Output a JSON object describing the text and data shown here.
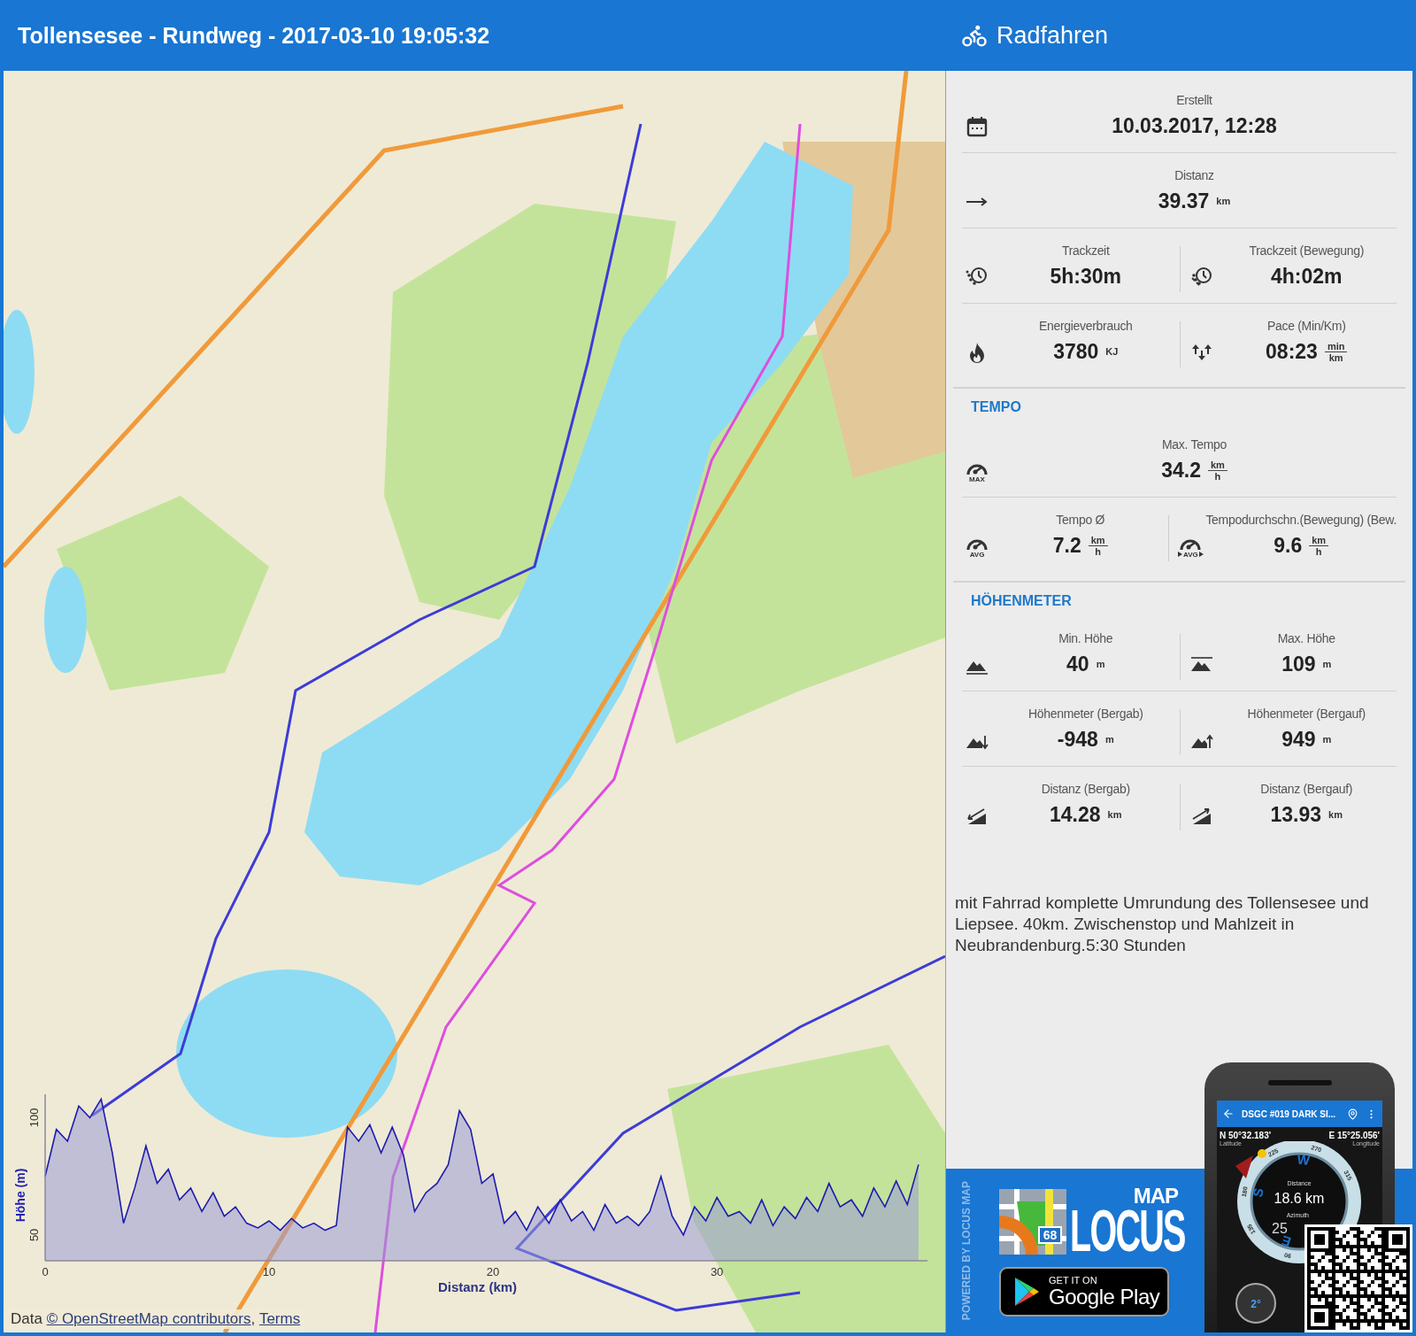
{
  "header": {
    "title": "Tollensesee - Rundweg - 2017-03-10 19:05:32",
    "activity": {
      "kind": "bike",
      "label": "Radfahren"
    }
  },
  "map": {
    "kind": "picture",
    "elevation_profile": {
      "chart_data": {
        "type": "area",
        "xlabel": "Distanz (km)",
        "ylabel": "Höhe (m)",
        "x": [
          0,
          0.5,
          1,
          1.5,
          2,
          2.5,
          3,
          3.5,
          4,
          4.5,
          5,
          5.5,
          6,
          6.5,
          7,
          7.5,
          8,
          8.5,
          9,
          9.5,
          10,
          10.5,
          11,
          11.5,
          12,
          12.5,
          13,
          13.5,
          14,
          14.5,
          15,
          15.5,
          16,
          16.5,
          17,
          17.5,
          18,
          18.5,
          19,
          19.5,
          20,
          20.5,
          21,
          21.5,
          22,
          22.5,
          23,
          23.5,
          24,
          24.5,
          25,
          25.5,
          26,
          26.5,
          27,
          27.5,
          28,
          28.5,
          29,
          29.5,
          30,
          30.5,
          31,
          31.5,
          32,
          32.5,
          33,
          33.5,
          34,
          34.5,
          35,
          35.5,
          36,
          36.5,
          37,
          37.5,
          38,
          38.5,
          39
        ],
        "series": [
          {
            "color": "#1c1cae",
            "values": [
              75,
              95,
              90,
              105,
              100,
              108,
              85,
              55,
              70,
              88,
              72,
              78,
              65,
              70,
              60,
              68,
              58,
              62,
              55,
              53,
              56,
              52,
              57,
              53,
              55,
              52,
              54,
              96,
              90,
              97,
              85,
              96,
              84,
              60,
              68,
              72,
              80,
              103,
              95,
              72,
              76,
              55,
              60,
              52,
              62,
              55,
              65,
              56,
              60,
              52,
              63,
              55,
              58,
              54,
              60,
              75,
              58,
              50,
              62,
              56,
              66,
              58,
              60,
              55,
              65,
              54,
              62,
              57,
              66,
              60,
              72,
              62,
              65,
              58,
              70,
              62,
              73,
              63,
              80
            ]
          }
        ],
        "xlim": [
          0,
          39.4
        ],
        "ylim": [
          39,
          110
        ],
        "xticks": [
          0,
          10,
          20,
          30
        ],
        "yticks": [
          50,
          100
        ]
      }
    },
    "attribution": {
      "prefix": "Data",
      "link": "© OpenStreetMap contributors",
      "separator": ",",
      "terms": "Terms"
    }
  },
  "stats": {
    "sections": [
      {
        "rows": [
          {
            "cells": [
              {
                "kind": "calendar",
                "label": "Erstellt",
                "value": "10.03.2017, 12:28"
              }
            ]
          },
          {
            "cells": [
              {
                "kind": "arrow",
                "label": "Distanz",
                "value": "39.37",
                "unit": "km"
              }
            ]
          },
          {
            "cells": [
              {
                "kind": "clock",
                "label": "Trackzeit",
                "value": "5h:30m"
              },
              {
                "kind": "clockmoving",
                "label": "Trackzeit (Bewegung)",
                "value": "4h:02m"
              }
            ]
          },
          {
            "cells": [
              {
                "kind": "flame",
                "label": "Energieverbrauch",
                "value": "3780",
                "unit": "KJ"
              },
              {
                "kind": "pace",
                "label": "Pace (Min/Km)",
                "value": "08:23",
                "unit_fraction": [
                  "min",
                  "km"
                ]
              }
            ]
          }
        ]
      },
      {
        "heading": "TEMPO",
        "rows": [
          {
            "cells": [
              {
                "kind": "gauge",
                "icon_text": "MAX",
                "label": "Max. Tempo",
                "value": "34.2",
                "unit_fraction": [
                  "km",
                  "h"
                ]
              }
            ]
          },
          {
            "cells": [
              {
                "kind": "gauge",
                "icon_text": "AVG",
                "label": "Tempo Ø",
                "value": "7.2",
                "unit_fraction": [
                  "km",
                  "h"
                ]
              },
              {
                "kind": "gaugemoving",
                "icon_text": "AVG",
                "label": "Tempodurchschn.(Bewegung) (Bew.",
                "value": "9.6",
                "unit_fraction": [
                  "km",
                  "h"
                ]
              }
            ]
          }
        ]
      },
      {
        "heading": "HÖHENMETER",
        "rows": [
          {
            "cells": [
              {
                "kind": "minheight",
                "label": "Min. Höhe",
                "value": "40",
                "unit": "m"
              },
              {
                "kind": "maxheight",
                "label": "Max. Höhe",
                "value": "109",
                "unit": "m"
              }
            ]
          },
          {
            "cells": [
              {
                "kind": "descent",
                "label": "Höhenmeter (Bergab)",
                "value": "-948",
                "unit": "m"
              },
              {
                "kind": "ascent",
                "label": "Höhenmeter (Bergauf)",
                "value": "949",
                "unit": "m"
              }
            ]
          },
          {
            "cells": [
              {
                "kind": "slopedown",
                "label": "Distanz (Bergab)",
                "value": "14.28",
                "unit": "km"
              },
              {
                "kind": "slopeup",
                "label": "Distanz (Bergauf)",
                "value": "13.93",
                "unit": "km"
              }
            ]
          }
        ]
      }
    ]
  },
  "description": "mit Fahrrad komplette Umrundung des Tollensesee und Liepsee. 40km. Zwischenstop und Mahlzeit in Neubrandenburg.5:30 Stunden",
  "promo": {
    "tagline": "POWERED BY LOCUS MAP",
    "logo_badge": "68",
    "logo_small": "MAP",
    "logo_big": "LOCUS",
    "store_badge": {
      "top": "GET IT ON",
      "bottom": "Google Play"
    },
    "phone": {
      "title": "DSGC #019 DARK SI...",
      "latitude": "N 50°32.183'",
      "latitude_label": "Latitude",
      "longitude": "E 15°25.056'",
      "longitude_label": "Longitude",
      "distance_label": "Distance",
      "distance": "18.6 km",
      "azimuth_label": "Azimuth",
      "azimuth": "25",
      "level_button": "2°",
      "compass_labels": [
        {
          "kind": "degree",
          "text": "270"
        },
        {
          "kind": "degree",
          "text": "225"
        },
        {
          "kind": "degree",
          "text": "315"
        },
        {
          "kind": "degree",
          "text": "180"
        },
        {
          "kind": "degree",
          "text": "135"
        },
        {
          "kind": "degree",
          "text": "90"
        },
        {
          "kind": "cardinal",
          "text": "W"
        },
        {
          "kind": "cardinal",
          "text": "S"
        },
        {
          "kind": "cardinal",
          "text": "E"
        }
      ]
    }
  }
}
